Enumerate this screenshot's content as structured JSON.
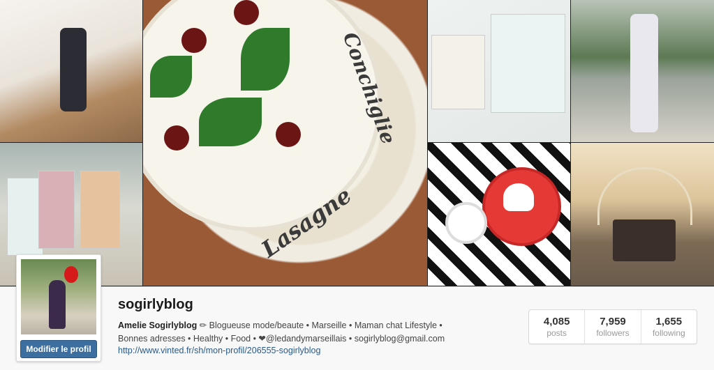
{
  "profile": {
    "username": "sogirlyblog",
    "edit_button_label": "Modifier le profil",
    "bio_name": "Amelie Sogirlyblog",
    "bio_line_1": " ✏ Blogueuse mode/beaute • Marseille  • Maman chat  Lifestyle •",
    "bio_line_2": "Bonnes adresses • Healthy  • Food • ❤@ledandymarseillais • sogirlyblog@gmail.com",
    "website": "http://www.vinted.fr/sh/mon-profil/206555-sogirlyblog"
  },
  "stats": [
    {
      "value": "4,085",
      "label": "posts"
    },
    {
      "value": "7,959",
      "label": "followers"
    },
    {
      "value": "1,655",
      "label": "following"
    }
  ],
  "mosaic": {
    "pasta_text_1": "Lasagne",
    "pasta_text_2": "Conchiglie"
  }
}
